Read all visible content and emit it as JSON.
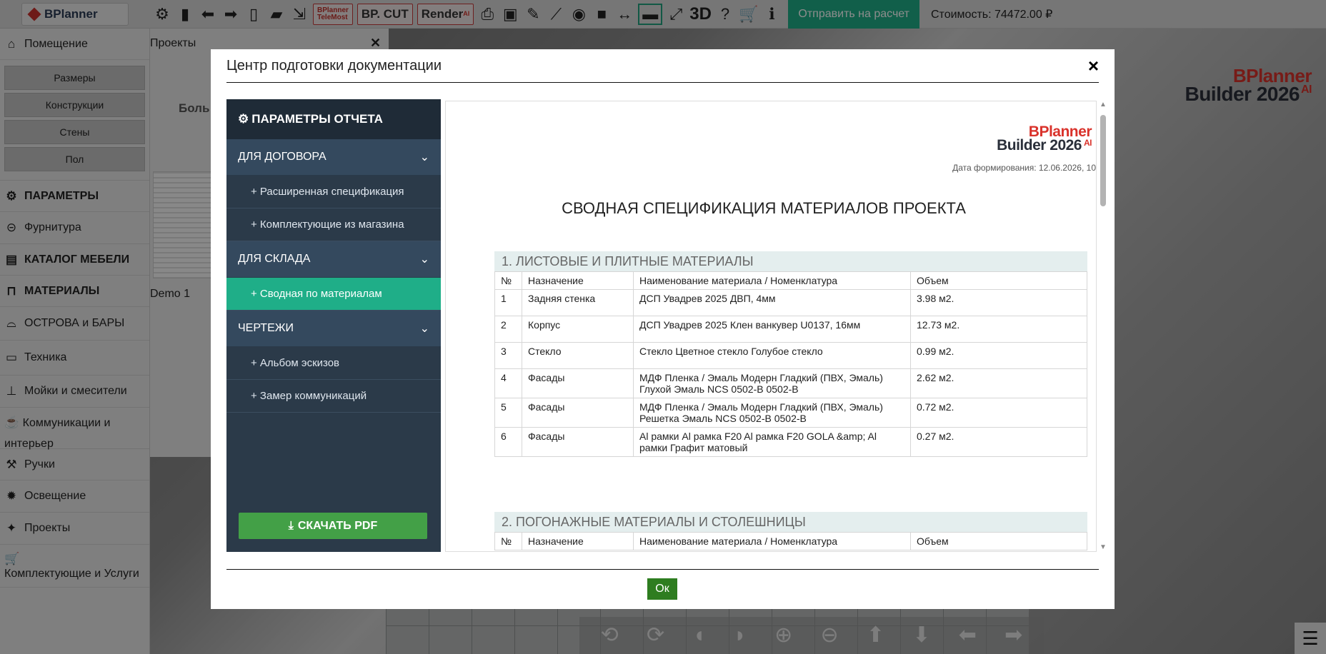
{
  "app": {
    "logo_text": "BPlanner",
    "brand_line1": "BPlanner",
    "brand_line2": "Builder 2026",
    "brand_ai": "AI"
  },
  "toolbar": {
    "icons": [
      "gear-icon",
      "device-icon",
      "arrow-left-icon",
      "arrow-right-icon",
      "file-icon",
      "folder-open-icon",
      "save-icon"
    ],
    "telemost_line1": "BPlanner",
    "telemost_line2": "TeleMost",
    "bpcut_label": "BP. CUT",
    "render_label": "Render",
    "render_ai": "AI",
    "tools2": [
      "print-icon",
      "image-icon",
      "pencil-icon",
      "ruler-icon",
      "eye-icon",
      "camera-icon",
      "resize-h-icon",
      "chat-icon",
      "fullscreen-icon"
    ],
    "three_d": "3D",
    "calc_button": "Отправить на расчет",
    "cost_label": "Стоимость: 74472.00 ₽"
  },
  "sidebar": {
    "room": "Помещение",
    "sub_buttons": [
      "Размеры",
      "Конструкции",
      "Стены",
      "Пол"
    ],
    "items": [
      {
        "label": "ПАРАМЕТРЫ",
        "icon": "gear-icon",
        "bold": true
      },
      {
        "label": "Фурнитура",
        "icon": "hardware-icon",
        "bold": false
      },
      {
        "label": "КАТАЛОГ МЕБЕЛИ",
        "icon": "cabinet-icon",
        "bold": true
      },
      {
        "label": "МАТЕРИАЛЫ",
        "icon": "paint-roller-icon",
        "bold": true
      },
      {
        "label": "ОСТРОВА и БАРЫ",
        "icon": "island-icon",
        "bold": false
      },
      {
        "label": "Техника",
        "icon": "monitor-icon",
        "bold": false
      },
      {
        "label": "Мойки и смесители",
        "icon": "faucet-icon",
        "bold": false
      },
      {
        "label": "Коммуникации и интерьер",
        "icon": "cup-icon",
        "bold": false
      },
      {
        "label": "Ручки",
        "icon": "handle-icon",
        "bold": false
      },
      {
        "label": "Освещение",
        "icon": "light-icon",
        "bold": false
      },
      {
        "label": "Проекты",
        "icon": "magic-icon",
        "bold": false
      },
      {
        "label": "Комплектующие и Услуги",
        "icon": "cart-icon",
        "bold": false
      }
    ]
  },
  "projects_panel": {
    "title": "Проекты",
    "text": "Боль посм с",
    "demo_label": "Demo 1"
  },
  "modal": {
    "title": "Центр подготовки документации",
    "ok_label": "Ок",
    "report_params": {
      "header": "ПАРАМЕТРЫ ОТЧЕТА",
      "sec1": "ДЛЯ ДОГОВОРА",
      "sec1_links": [
        "+ Расширенная спецификация",
        "+ Комплектующие из магазина"
      ],
      "sec2": "ДЛЯ СКЛАДА",
      "sec2_links": [
        "+ Сводная по материалам"
      ],
      "sec3": "ЧЕРТЕЖИ",
      "sec3_links": [
        "+ Альбом эскизов",
        "+ Замер коммуникаций"
      ],
      "download": "СКАЧАТЬ PDF"
    },
    "document": {
      "logo_line1": "BPlanner",
      "logo_line2": "Builder 2026",
      "logo_ai": "AI",
      "date": "Дата формирования: 12.06.2026, 10",
      "title": "СВОДНАЯ СПЕЦИФИКАЦИЯ МАТЕРИАЛОВ ПРОЕКТА",
      "section1": {
        "title": "1. ЛИСТОВЫЕ И ПЛИТНЫЕ МАТЕРИАЛЫ",
        "headers": [
          "№",
          "Назначение",
          "Наименование материала / Номенклатура",
          "Объем"
        ],
        "rows": [
          [
            "1",
            "Задняя стенка",
            "ДСП Увадрев 2025 ДВП, 4мм",
            "3.98 м2."
          ],
          [
            "2",
            "Корпус",
            "ДСП Увадрев 2025 Клен ванкувер U0137, 16мм",
            "12.73 м2."
          ],
          [
            "3",
            "Стекло",
            "Стекло Цветное стекло Голубое стекло",
            "0.99 м2."
          ],
          [
            "4",
            "Фасады",
            "МДФ Пленка / Эмаль Модерн Гладкий (ПВХ, Эмаль) Глухой Эмаль NCS 0502-B 0502-B",
            "2.62 м2."
          ],
          [
            "5",
            "Фасады",
            "МДФ Пленка / Эмаль Модерн Гладкий (ПВХ, Эмаль) Решетка Эмаль NCS 0502-B 0502-B",
            "0.72 м2."
          ],
          [
            "6",
            "Фасады",
            "Al рамки Al рамка F20 Al рамка F20 GOLA &amp; Al рамки Графит матовый",
            "0.27 м2."
          ]
        ]
      },
      "section2": {
        "title": "2. ПОГОНАЖНЫЕ МАТЕРИАЛЫ И СТОЛЕШНИЦЫ",
        "headers": [
          "№",
          "Назначение",
          "Наименование материала / Номенклатура",
          "Объем"
        ]
      }
    }
  }
}
